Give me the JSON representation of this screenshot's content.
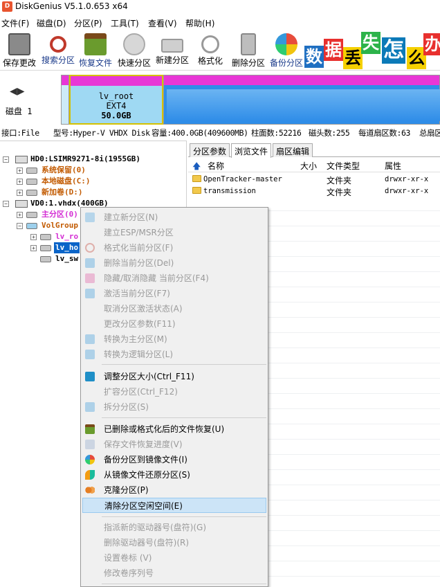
{
  "window": {
    "title": "DiskGenius V5.1.0.653 x64"
  },
  "menu": [
    "文件(F)",
    "磁盘(D)",
    "分区(P)",
    "工具(T)",
    "查看(V)",
    "帮助(H)"
  ],
  "toolbar": [
    "保存更改",
    "搜索分区",
    "恢复文件",
    "快速分区",
    "新建分区",
    "格式化",
    "删除分区",
    "备份分区"
  ],
  "banner": [
    "数",
    "据",
    "丢",
    "失",
    "怎",
    "么",
    "办"
  ],
  "disk": {
    "label": "磁盘 1",
    "partition_name": "lv_root",
    "partition_fs": "EXT4",
    "partition_size": "50.0GB"
  },
  "infobar": {
    "interface": "接口:File",
    "model": "型号:Hyper-V VHDX Disk",
    "capacity": "容量:400.0GB(409600MB)",
    "cylinders": "柱面数:52216",
    "heads": "磁头数:255",
    "sectors": "每道扇区数:63",
    "total": "总扇区"
  },
  "tree": {
    "hd0": "HD0:LSIMR9271-8i(1955GB)",
    "sys_reserved": "系统保留(0)",
    "local_c": "本地磁盘(C:)",
    "new_d": "新加卷(D:)",
    "vd0": "VD0:1.vhdx(400GB)",
    "primary": "主分区(0)",
    "volgroup": "VolGroup",
    "lv_root": "lv_ro",
    "lv_home": "lv_ho",
    "lv_swap": "lv_sw"
  },
  "tabs": [
    "分区参数",
    "浏览文件",
    "扇区编辑"
  ],
  "file_columns": {
    "name": "名称",
    "size": "大小",
    "type": "文件类型",
    "attr": "属性"
  },
  "files": [
    {
      "name": "OpenTracker-master",
      "type": "文件夹",
      "attr": "drwxr-xr-x"
    },
    {
      "name": "transmission",
      "type": "文件夹",
      "attr": "drwxr-xr-x"
    }
  ],
  "context_menu": [
    {
      "label": "建立新分区(N)",
      "enabled": false
    },
    {
      "label": "建立ESP/MSR分区",
      "enabled": false
    },
    {
      "label": "格式化当前分区(F)",
      "enabled": false
    },
    {
      "label": "删除当前分区(Del)",
      "enabled": false
    },
    {
      "label": "隐藏/取消隐藏 当前分区(F4)",
      "enabled": false
    },
    {
      "label": "激活当前分区(F7)",
      "enabled": false
    },
    {
      "label": "取消分区激活状态(A)",
      "enabled": false
    },
    {
      "label": "更改分区参数(F11)",
      "enabled": false
    },
    {
      "label": "转换为主分区(M)",
      "enabled": false
    },
    {
      "label": "转换为逻辑分区(L)",
      "enabled": false
    },
    {
      "label": "调整分区大小(Ctrl_F11)",
      "enabled": true
    },
    {
      "label": "扩容分区(Ctrl_F12)",
      "enabled": false
    },
    {
      "label": "拆分分区(S)",
      "enabled": false
    },
    {
      "label": "已删除或格式化后的文件恢复(U)",
      "enabled": true
    },
    {
      "label": "保存文件恢复进度(V)",
      "enabled": false
    },
    {
      "label": "备份分区到镜像文件(I)",
      "enabled": true
    },
    {
      "label": "从镜像文件还原分区(S)",
      "enabled": true
    },
    {
      "label": "克隆分区(P)",
      "enabled": true
    },
    {
      "label": "清除分区空闲空间(E)",
      "enabled": true
    },
    {
      "label": "指派新的驱动器号(盘符)(G)",
      "enabled": false
    },
    {
      "label": "删除驱动器号(盘符)(R)",
      "enabled": false
    },
    {
      "label": "设置卷标 (V)",
      "enabled": false
    },
    {
      "label": "修改卷序列号",
      "enabled": false
    }
  ],
  "colors": {
    "accent": "#0078d7",
    "partition_cap": "#e837d6",
    "root_border": "#d5c100",
    "tree_orange": "#c25a00",
    "tree_magenta": "#d42ed4"
  }
}
